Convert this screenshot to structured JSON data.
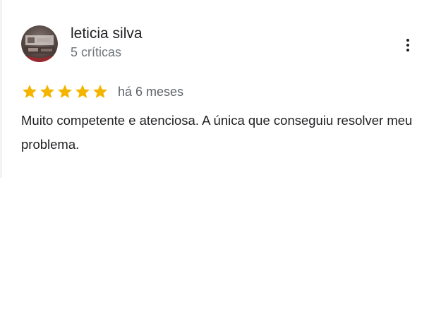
{
  "review": {
    "user_name": "leticia silva",
    "review_count": "5 críticas",
    "rating": 5,
    "rating_max": 5,
    "time_ago": "há 6 meses",
    "text": "Muito competente e atenciosa. A única que conseguiu resolver meu problema.",
    "star_color": "#f4b400"
  },
  "icons": {
    "avatar": "user-avatar-photo",
    "more": "more-vert-icon",
    "star": "star-icon"
  }
}
